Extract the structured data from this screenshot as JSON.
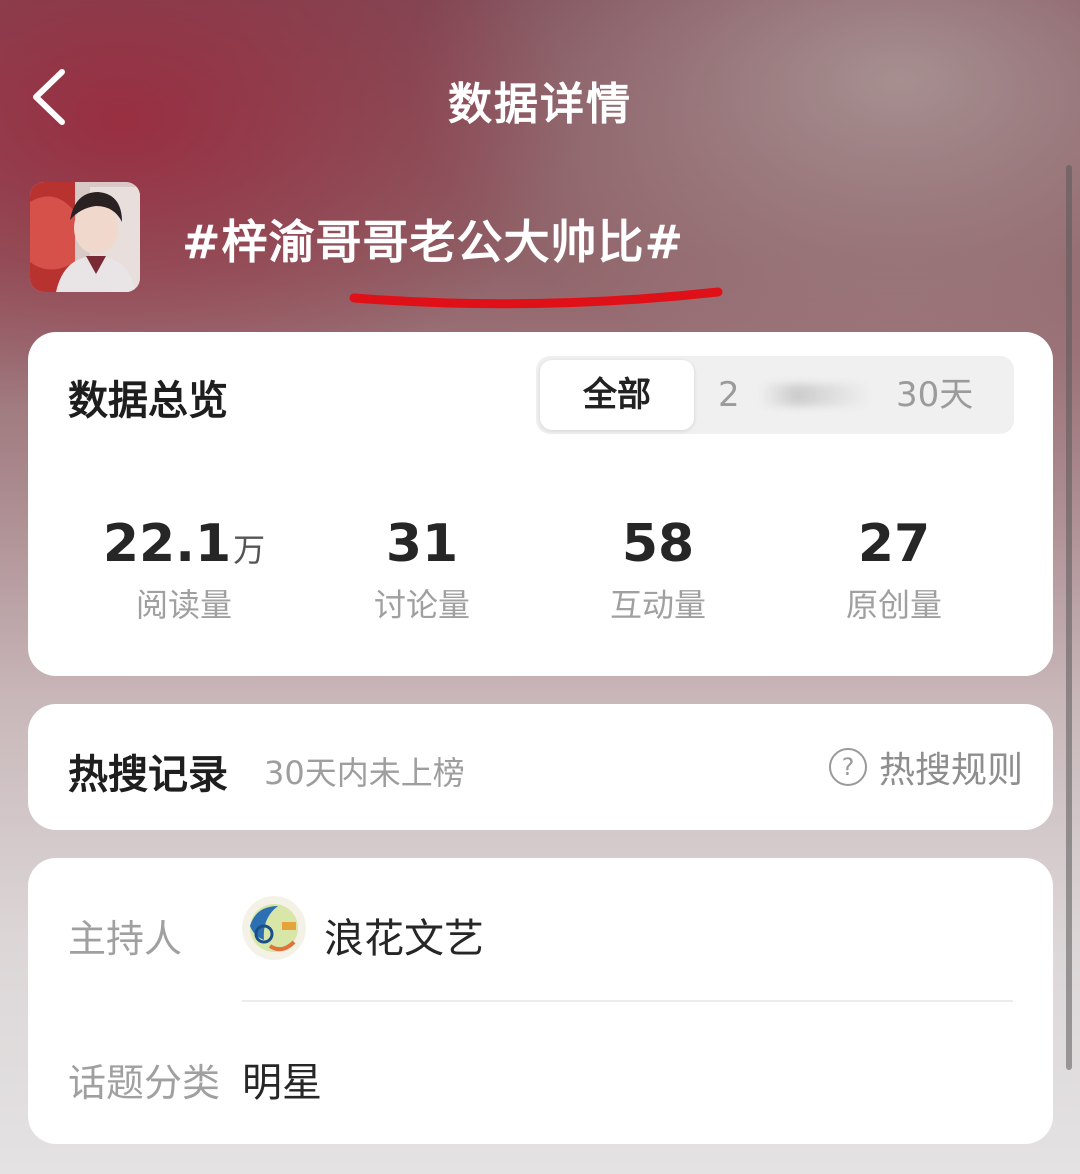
{
  "header": {
    "title": "数据详情"
  },
  "topic": {
    "title": "#梓渝哥哥老公大帅比#"
  },
  "overview": {
    "title": "数据总览",
    "tabs": {
      "all": "全部",
      "range_start": "2",
      "range_end": "30天"
    },
    "stats": [
      {
        "value": "22.1",
        "unit": "万",
        "label": "阅读量"
      },
      {
        "value": "31",
        "unit": "",
        "label": "讨论量"
      },
      {
        "value": "58",
        "unit": "",
        "label": "互动量"
      },
      {
        "value": "27",
        "unit": "",
        "label": "原创量"
      }
    ]
  },
  "hot_search": {
    "title": "热搜记录",
    "subtitle": "30天内未上榜",
    "rules_label": "热搜规则",
    "rules_icon": "?"
  },
  "info": {
    "host_label": "主持人",
    "host_name": "浪花文艺",
    "category_label": "话题分类",
    "category_value": "明星"
  }
}
